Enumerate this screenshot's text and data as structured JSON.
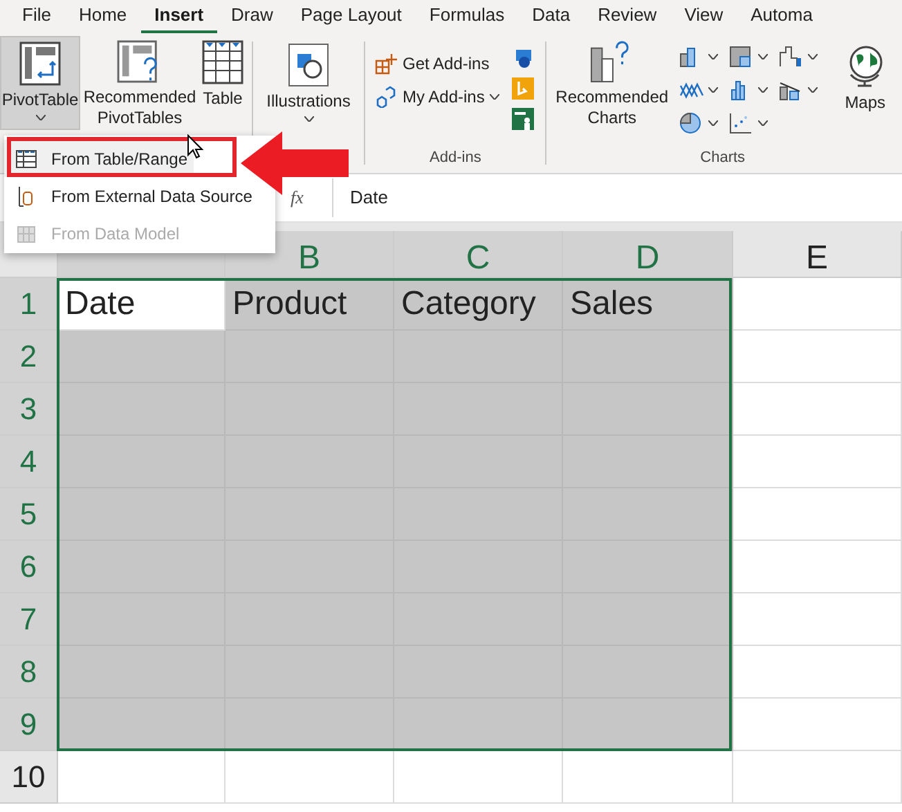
{
  "tabs": [
    {
      "label": "File",
      "selected": false
    },
    {
      "label": "Home",
      "selected": false
    },
    {
      "label": "Insert",
      "selected": true
    },
    {
      "label": "Draw",
      "selected": false
    },
    {
      "label": "Page Layout",
      "selected": false
    },
    {
      "label": "Formulas",
      "selected": false
    },
    {
      "label": "Data",
      "selected": false
    },
    {
      "label": "Review",
      "selected": false
    },
    {
      "label": "View",
      "selected": false
    },
    {
      "label": "Automa",
      "selected": false
    }
  ],
  "tables_group": {
    "pivot": {
      "label": "PivotTable",
      "pressed": true
    },
    "recommended": "Recommended PivotTables",
    "table": "Table"
  },
  "illustrations": "Illustrations",
  "addins_group": {
    "label": "Add-ins",
    "items": [
      "Get Add-ins",
      "My Add-ins"
    ]
  },
  "charts_group": {
    "label": "Charts",
    "recommended": "Recommended Charts"
  },
  "maps": "Maps",
  "menu": {
    "items": [
      {
        "label": "From Table/Range",
        "disabled": false,
        "highlighted": true
      },
      {
        "label": "From External Data Source",
        "disabled": false,
        "highlighted": false
      },
      {
        "label": "From Data Model",
        "disabled": true,
        "highlighted": false
      }
    ]
  },
  "formula_bar": {
    "fx": "fx",
    "value": "Date"
  },
  "sheet": {
    "columns": [
      {
        "selected": true
      },
      {
        "label": "B",
        "selected": true
      },
      {
        "label": "C",
        "selected": true
      },
      {
        "label": "D",
        "selected": true
      },
      {
        "label": "E",
        "selected": false
      }
    ],
    "rows": [
      {
        "label": "1",
        "selected": true,
        "cells": [
          {
            "text": "Date",
            "active": true
          },
          {
            "text": "Product",
            "active": false
          },
          {
            "text": "Category",
            "active": false
          },
          {
            "text": "Sales",
            "active": false
          }
        ]
      },
      {
        "label": "2",
        "selected": true
      },
      {
        "label": "3",
        "selected": true
      },
      {
        "label": "4",
        "selected": true
      },
      {
        "label": "5",
        "selected": true
      },
      {
        "label": "6",
        "selected": true
      },
      {
        "label": "7",
        "selected": true
      },
      {
        "label": "8",
        "selected": true
      },
      {
        "label": "9",
        "selected": true
      },
      {
        "label": "10",
        "selected": false
      }
    ]
  }
}
